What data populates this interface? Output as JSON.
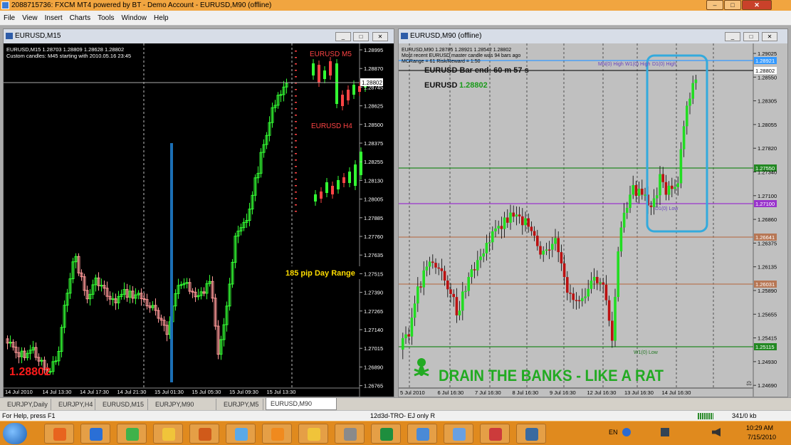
{
  "app": {
    "title": "2088715736: FXCM MT4 powered by BT - Demo Account - EURUSD,M90 (offline)",
    "window_controls": [
      "minimize",
      "maximize",
      "close"
    ]
  },
  "menu": [
    "File",
    "View",
    "Insert",
    "Charts",
    "Tools",
    "Window",
    "Help"
  ],
  "left_chart": {
    "title": "EURUSD,M15",
    "info_line1": "EURUSD,M15  1.28703 1.28809 1.28628 1.28802",
    "info_line2": "Custom candles: M45 starting with 2010.05.16 23:45",
    "label_m5": "EURUSD M5",
    "label_h4": "EURUSD H4",
    "range_label": "185 pip Day Range",
    "big_price": "1.28802",
    "current_price": "1.28802",
    "y_ticks": [
      "1.28995",
      "1.28870",
      "1.28745",
      "1.28625",
      "1.28500",
      "1.28375",
      "1.28255",
      "1.28130",
      "1.28005",
      "1.27885",
      "1.27760",
      "1.27635",
      "1.27515",
      "1.27390",
      "1.27265",
      "1.27140",
      "1.27015",
      "1.26890",
      "1.26765"
    ],
    "x_ticks": [
      "14 Jul 2010",
      "14 Jul 13:30",
      "14 Jul 17:30",
      "14 Jul 21:30",
      "15 Jul 01:30",
      "15 Jul 05:30",
      "15 Jul 09:30",
      "15 Jul 13:30"
    ],
    "colors": {
      "bg": "#000000",
      "up": "#33ff33",
      "down": "#ff9999",
      "label": "#ff3333",
      "range_bg": "#ffff00",
      "range_fg": "#ff0000",
      "bar": "#1b6fb5"
    }
  },
  "right_chart": {
    "title": "EURUSD,M90 (offline)",
    "info_line1": "EURUSD,M90  1.28785 1.28921 1.28542 1.28802",
    "info_line2": "Most recent EURUSD master candle was 94 bars ago",
    "info_line3": "MCRange = 61  Risk/Reward = 1:50",
    "bar_end": "EURUSD Bar end: 60 m 57 s",
    "symbol": "EURUSD",
    "symbol_price": "1.28802",
    "bottom_banner": "DRAIN THE BANKS - LIKE A RAT",
    "level_labels": {
      "mn_high": "MN(0) High",
      "w1_high": "W1(0) High",
      "d1_high": "D1(0) High",
      "d1_low": "D1(0) Low",
      "w1_low": "W1(0) Low"
    },
    "price_tags": {
      "p1": "1.28921",
      "p2": "1.28802",
      "p3": "1.27550",
      "p4": "1.27100",
      "p5": "1.26641",
      "p6": "1.26031",
      "p7": "1.25115"
    },
    "y_ticks": [
      "1.29025",
      "1.28550",
      "1.28305",
      "1.28055",
      "1.27820",
      "1.27340",
      "1.27100",
      "1.26860",
      "1.26375",
      "1.26135",
      "1.25890",
      "1.25655",
      "1.25415",
      "1.24930",
      "1.24690"
    ],
    "x_ticks": [
      "5 Jul 2010",
      "6 Jul 16:30",
      "7 Jul 16:30",
      "8 Jul 16:30",
      "9 Jul 16:30",
      "12 Jul 16:30",
      "13 Jul 16:30",
      "14 Jul 16:30"
    ],
    "colors": {
      "bg": "#c0c0c0",
      "up": "#22dd22",
      "down": "#bb1111",
      "level_green": "#228822",
      "level_purple": "#9933cc",
      "level_brown": "#b77755",
      "level_blue": "#3399ff",
      "box": "#33aadd",
      "banner": "#22aa22"
    }
  },
  "tabs": [
    "EURJPY,Daily",
    "EURJPY,H4",
    "EURUSD,M15",
    "EURJPY,M90 (offline)",
    "EURJPY,M5",
    "EURUSD,M90 (offline)"
  ],
  "active_tab": "EURUSD,M90 (offline)",
  "status": {
    "help": "For Help, press F1",
    "profile": "12d3d-TRO- EJ only R",
    "traffic": "341/0 kb"
  },
  "taskbar": {
    "apps": [
      "windows-start-icon",
      "firefox-icon",
      "app-z-icon",
      "green-app-icon",
      "explorer-folder-icon",
      "media-player-icon",
      "paint-icon",
      "outlook-icon",
      "yellow-folder-icon",
      "calculator-icon",
      "excel-icon",
      "ie-icon",
      "itunes-icon",
      "tools-icon",
      "mt4-icon"
    ],
    "lang": "EN",
    "time": "10:29 AM",
    "date": "7/15/2010"
  }
}
